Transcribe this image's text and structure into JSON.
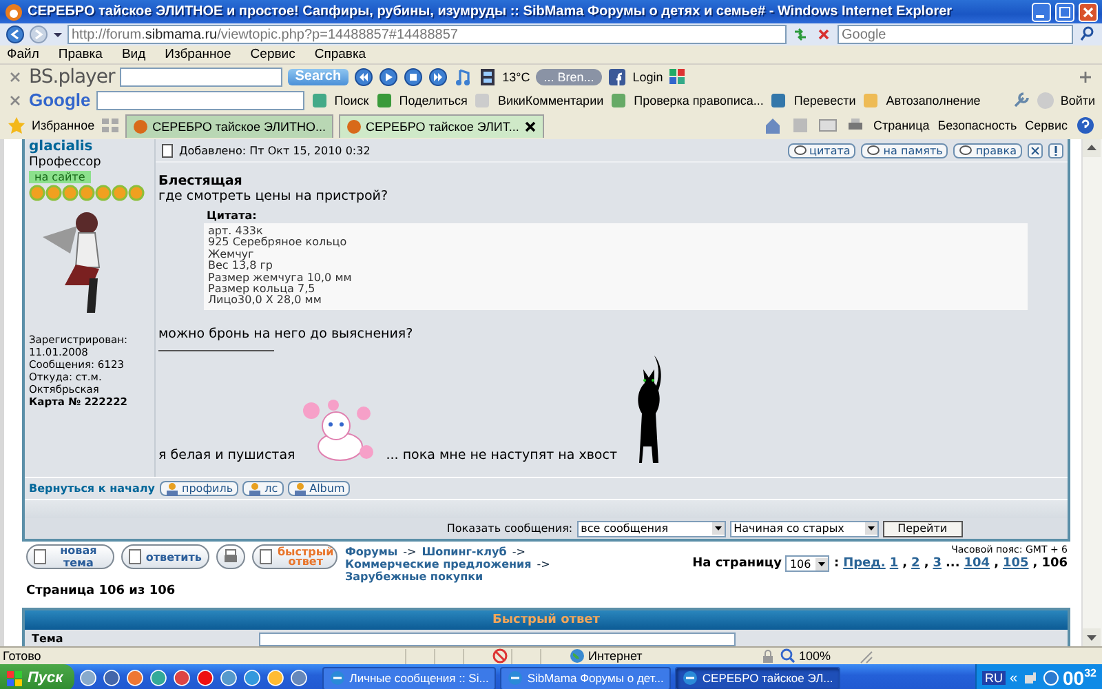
{
  "window": {
    "title": "СЕРЕБРО тайское ЭЛИТНОЕ и простое! Сапфиры, рубины, изумруды :: SibMama Форумы о детях и семье# - Windows Internet Explorer"
  },
  "address": {
    "url": "http://forum.**sibmama.ru**/viewtopic.php?p=14488857#14488857"
  },
  "search": {
    "placeholder": "Google"
  },
  "menu": [
    "Файл",
    "Правка",
    "Вид",
    "Избранное",
    "Сервис",
    "Справка"
  ],
  "bsplayer": {
    "logo": "BS.player",
    "search_button": "Search",
    "temperature": "13°C",
    "radio": "... Bren...",
    "login": "Login"
  },
  "google_bar": {
    "logo": "Google",
    "items": [
      "Поиск",
      "Поделиться",
      "ВикиКомментарии",
      "Проверка правописа...",
      "Перевести",
      "Автозаполнение"
    ],
    "signin": "Войти"
  },
  "favorites": "Избранное",
  "tabs": [
    {
      "label": "СЕРЕБРО тайское ЭЛИТНО...",
      "selected": false
    },
    {
      "label": "СЕРЕБРО тайское ЭЛИТ...",
      "selected": true
    }
  ],
  "command_bar": [
    "Страница",
    "Безопасность",
    "Сервис"
  ],
  "post": {
    "author": "glacialis",
    "rank": "Профессор",
    "online": "на сайте",
    "stars": 7,
    "profile": [
      {
        "text": "Зарегистрирован:",
        "bold": false
      },
      {
        "text": "11.01.2008",
        "bold": false
      },
      {
        "text": "Сообщения: 6123",
        "bold": false
      },
      {
        "text": "Откуда: ст.м.",
        "bold": false
      },
      {
        "text": "Октябрьская",
        "bold": false
      },
      {
        "text": "Карта № 222222",
        "bold": true
      }
    ],
    "posted": "Добавлено: Пт Окт 15, 2010 0:32",
    "buttons": [
      "цитата",
      "на память",
      "правка"
    ],
    "title": "Блестящая",
    "question": "где смотреть цены на пристрой?",
    "quote_label": "Цитата:",
    "quote_lines": [
      "арт. 433к",
      "925 Серебряное кольцо",
      "Жемчуг",
      "Вес 13,8 гр",
      "Размер жемчуга 10,0 мм",
      "Размер кольца 7,5",
      "Лицо30,0 Х 28,0 мм"
    ],
    "followup": "можно бронь на него до выяснения?",
    "signature": [
      "я белая и пушистая",
      "... пока мне не наступят на хвост"
    ],
    "back_to_top": "Вернуться к началу",
    "footer_buttons": [
      "профиль",
      "лс",
      "Album"
    ]
  },
  "display": {
    "label": "Показать сообщения:",
    "filter": "все сообщения",
    "order": "Начиная со старых",
    "go": "Перейти"
  },
  "nav": {
    "buttons": [
      {
        "kind": "new",
        "text": "новая тема"
      },
      {
        "kind": "reply",
        "text": "ответить"
      },
      {
        "kind": "print"
      },
      {
        "kind": "quick",
        "text": "быстрый ответ"
      }
    ],
    "breadcrumb": [
      {
        "kind": "link",
        "text": "Форумы"
      },
      {
        "kind": "sep",
        "text": "->"
      },
      {
        "kind": "link",
        "text": "Шопинг-клуб"
      },
      {
        "kind": "sep",
        "text": "->"
      },
      {
        "kind": "link",
        "text": "Коммерческие предложения"
      },
      {
        "kind": "sep",
        "text": "->"
      },
      {
        "kind": "link",
        "text": "Зарубежные покупки"
      }
    ],
    "timezone": "Часовой пояс: GMT + 6",
    "goto_label": "На страницу",
    "goto_value": "106",
    "pages": [
      {
        "kind": "text",
        "text": ":"
      },
      {
        "kind": "link",
        "text": "Пред."
      },
      {
        "kind": "link",
        "text": "1"
      },
      {
        "kind": "text",
        "text": ","
      },
      {
        "kind": "link",
        "text": "2"
      },
      {
        "kind": "text",
        "text": ","
      },
      {
        "kind": "link",
        "text": "3"
      },
      {
        "kind": "text",
        "text": "..."
      },
      {
        "kind": "link",
        "text": "104"
      },
      {
        "kind": "text",
        "text": ","
      },
      {
        "kind": "link",
        "text": "105"
      },
      {
        "kind": "text",
        "text": ","
      },
      {
        "kind": "current",
        "text": "106"
      }
    ],
    "page_count": "Страница 106 из 106"
  },
  "quick_reply": {
    "title": "Быстрый ответ",
    "subject_label": "Тема"
  },
  "status_bar": {
    "text": "Готово",
    "zone": "Интернет",
    "zoom": "100%"
  },
  "taskbar": {
    "start": "Пуск",
    "tasks": [
      {
        "label": "Личные сообщения :: Si...",
        "selected": false
      },
      {
        "label": "SibMama Форумы о дет...",
        "selected": false
      },
      {
        "label": "СЕРЕБРО тайское ЭЛ...",
        "selected": true
      }
    ],
    "language": "RU",
    "collapse": "«",
    "hours": "00",
    "minutes": "32"
  }
}
